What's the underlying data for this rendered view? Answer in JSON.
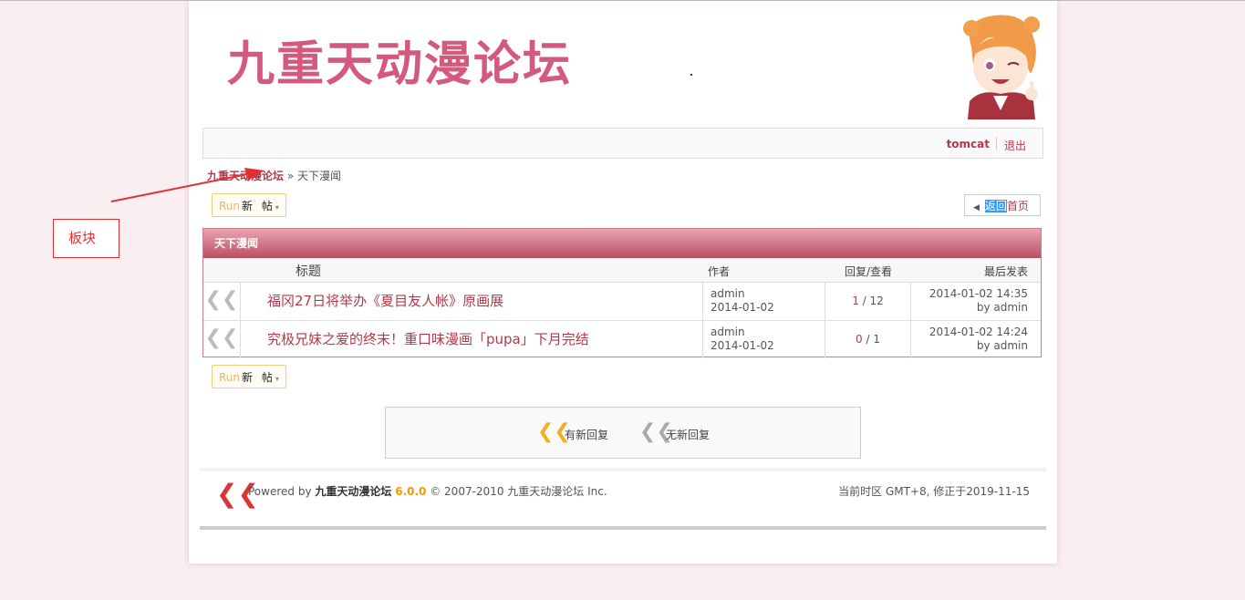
{
  "site": {
    "logo_text": "九重天动漫论坛"
  },
  "userbar": {
    "username": "tomcat",
    "logout": "退出"
  },
  "breadcrumb": {
    "home": "九重天动漫论坛",
    "separator": "»",
    "current": "天下漫闻"
  },
  "buttons": {
    "new_post_run": "Run",
    "new_post_label": "新 帖",
    "new_post_caret": "▾",
    "back_highlight": "返回",
    "back_rest": "首页"
  },
  "forum": {
    "name": "天下漫闻",
    "columns": {
      "title": "标题",
      "author": "作者",
      "replies": "回复/查看",
      "last": "最后发表"
    },
    "threads": [
      {
        "title": "福冈27日将举办《夏目友人帐》原画展",
        "author": "admin",
        "date": "2014-01-02",
        "replies": "1",
        "views": "12",
        "last_time": "2014-01-02 14:35",
        "last_by": "by admin"
      },
      {
        "title": "究极兄妹之爱的终末！重口味漫画「pupa」下月完结",
        "author": "admin",
        "date": "2014-01-02",
        "replies": "0",
        "views": "1",
        "last_time": "2014-01-02 14:24",
        "last_by": "by admin"
      }
    ]
  },
  "legend": {
    "new_reply": "有新回复",
    "no_new_reply": "无新回复"
  },
  "footer": {
    "powered_prefix": "Powered by",
    "brand": "九重天动漫论坛",
    "version": "6.0.0",
    "copyright": "© 2007-2010 九重天动漫论坛 Inc.",
    "timezone": "当前时区 GMT+8, 修正于2019-11-15"
  },
  "annotation": {
    "label": "板块",
    "color": "#e03030"
  },
  "colors": {
    "accent": "#b4394a",
    "logo": "#d35a7c",
    "page_bg": "#f9eef0"
  }
}
